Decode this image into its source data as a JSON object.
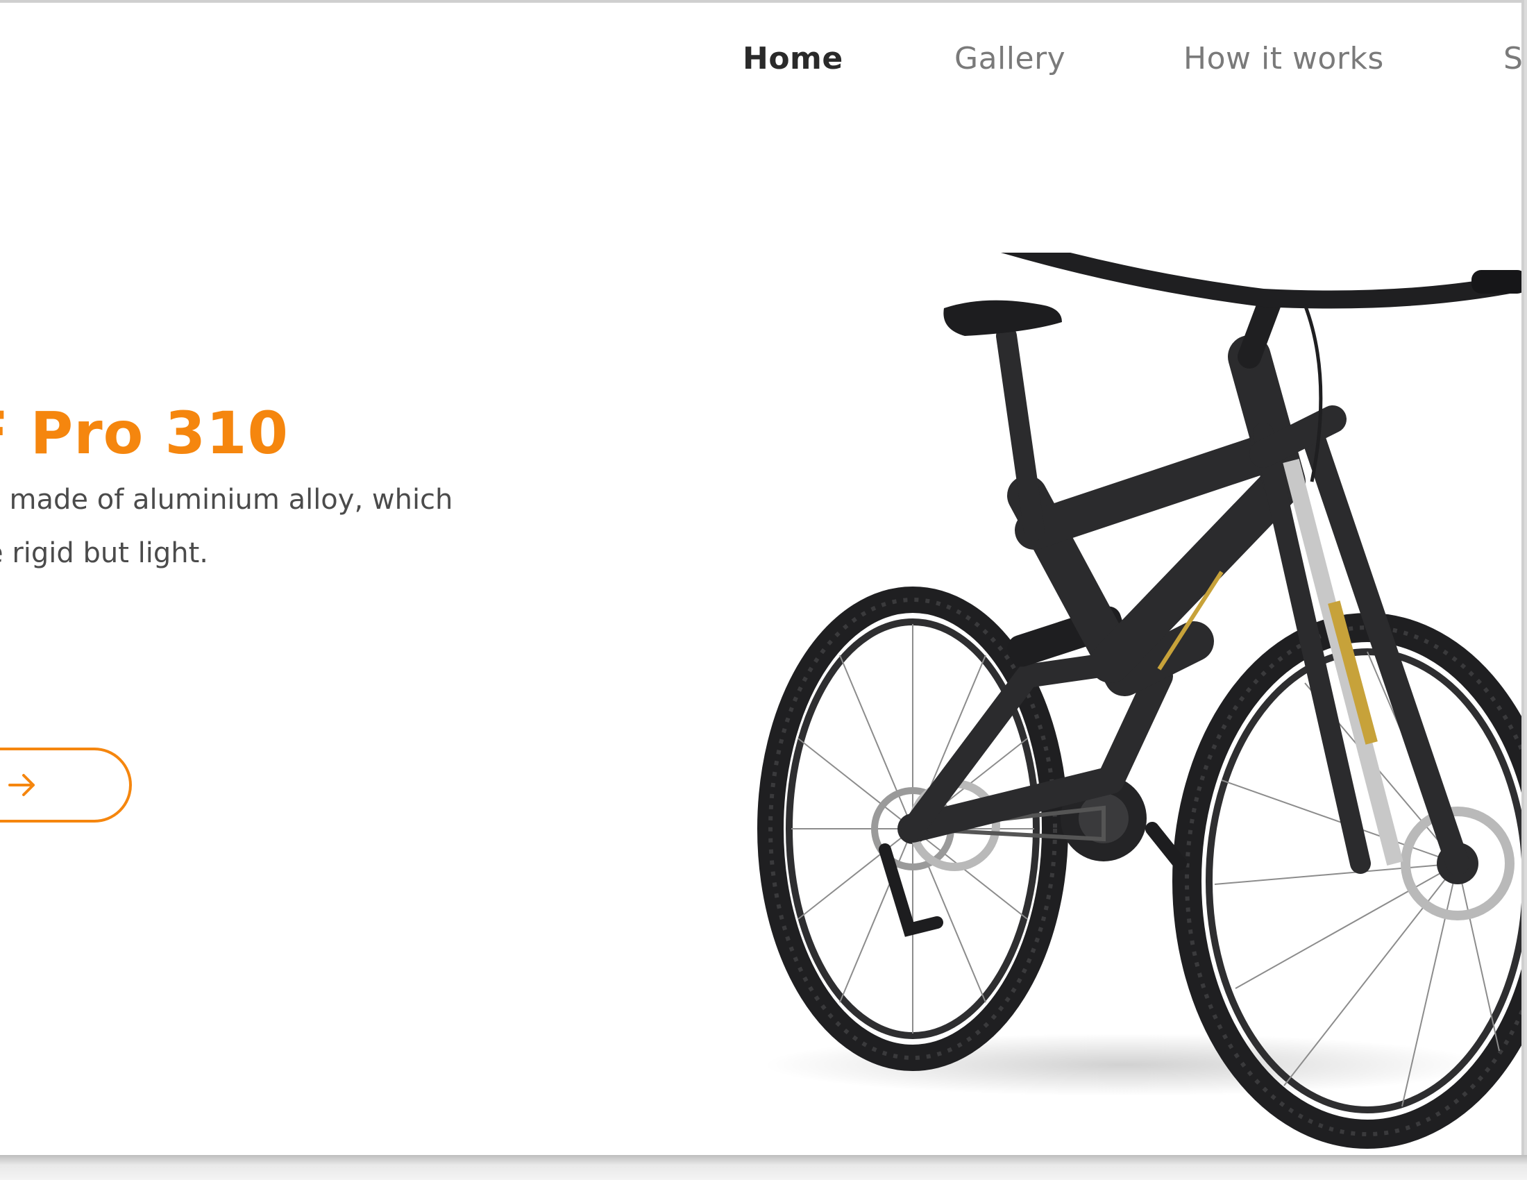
{
  "nav": {
    "items": [
      {
        "label": "Home",
        "active": true
      },
      {
        "label": "Gallery",
        "active": false
      },
      {
        "label": "How it works",
        "active": false
      },
      {
        "label": "S",
        "active": false
      }
    ]
  },
  "hero": {
    "title": "F Pro 310",
    "description_lines": [
      "s made of aluminium alloy, which",
      "e rigid but light."
    ],
    "cta_icon": "arrow-right-icon"
  },
  "product_image": {
    "icon": "mountain-bike-image"
  },
  "colors": {
    "accent": "#f5860e",
    "text_dark": "#2a2a2a",
    "text_muted": "#7a7a7a",
    "bike_frame": "#2b2b2d",
    "bike_decal": "#c7a23a"
  }
}
